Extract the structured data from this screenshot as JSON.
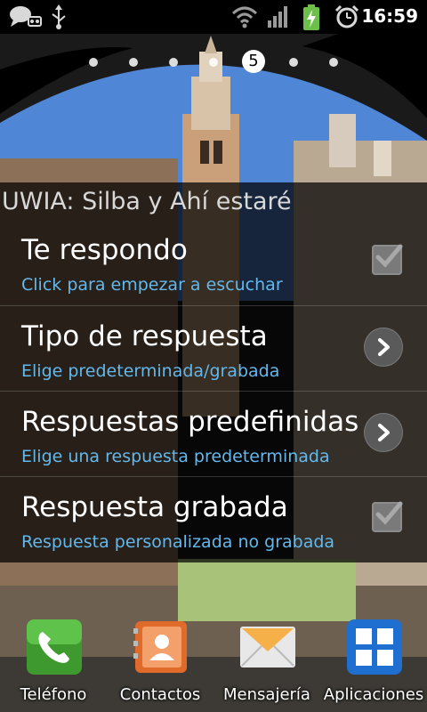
{
  "status_bar": {
    "time": "16:59",
    "icons": [
      "chat-notification-icon",
      "usb-icon",
      "wifi-icon",
      "signal-icon",
      "battery-charging-icon",
      "alarm-icon"
    ]
  },
  "home": {
    "current_page": "5",
    "page_count": 7
  },
  "widget": {
    "title": "UWIA: Silba y Ahí estaré",
    "rows": [
      {
        "title": "Te respondo",
        "subtitle": "Click para empezar a escuchar",
        "control": "checkbox",
        "checked": true
      },
      {
        "title": "Tipo de respuesta",
        "subtitle": "Elige predeterminada/grabada",
        "control": "chevron"
      },
      {
        "title": "Respuestas predefinidas",
        "subtitle": "Elige una respuesta predeterminada",
        "control": "chevron"
      },
      {
        "title": "Respuesta grabada",
        "subtitle": "Respuesta personalizada no grabada",
        "control": "checkbox",
        "checked": true
      }
    ]
  },
  "dock": [
    {
      "label": "Teléfono",
      "icon": "phone-icon"
    },
    {
      "label": "Contactos",
      "icon": "contacts-icon"
    },
    {
      "label": "Mensajería",
      "icon": "messaging-icon"
    },
    {
      "label": "Aplicaciones",
      "icon": "apps-grid-icon"
    }
  ],
  "colors": {
    "accent": "#63b8ec",
    "sky": "#4f86d6",
    "widget_bg": "#000000"
  }
}
